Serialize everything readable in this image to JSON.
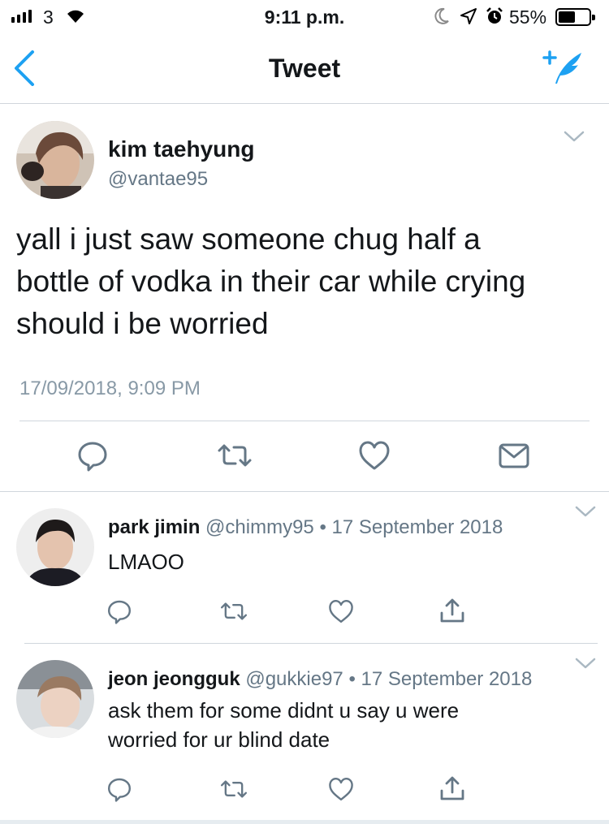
{
  "status_bar": {
    "carrier": "3",
    "time": "9:11 p.m.",
    "battery_pct": "55%",
    "battery_level": 0.55,
    "icons": [
      "signal-icon",
      "wifi-icon",
      "moon-icon",
      "location-icon",
      "alarm-icon",
      "battery-icon"
    ]
  },
  "nav": {
    "title": "Tweet",
    "icons": [
      "back-chevron-icon",
      "compose-tweet-icon"
    ]
  },
  "colors": {
    "accent": "#1da1f2",
    "secondary_text": "#657786",
    "divider": "#d0d6dc"
  },
  "main_tweet": {
    "name": "kim taehyung",
    "handle": "@vantae95",
    "text_lines": [
      "yall i just saw someone chug half a",
      "bottle of vodka in their car while crying",
      "should i be worried"
    ],
    "timestamp": "17/09/2018, 9:09 PM",
    "actions": [
      "reply-icon",
      "retweet-icon",
      "like-icon",
      "direct-message-icon"
    ]
  },
  "replies": [
    {
      "name": "park jimin",
      "handle": "@chimmy95",
      "dot": "•",
      "date": "17 September 2018",
      "text_lines": [
        "LMAOO"
      ],
      "actions": [
        "reply-icon",
        "retweet-icon",
        "like-icon",
        "share-icon"
      ]
    },
    {
      "name": "jeon jeongguk",
      "handle": "@gukkie97",
      "dot": "•",
      "date": "17 September 2018",
      "text_lines": [
        "ask them for some didnt u say u were",
        "worried for ur blind date"
      ],
      "actions": [
        "reply-icon",
        "retweet-icon",
        "like-icon",
        "share-icon"
      ]
    }
  ]
}
